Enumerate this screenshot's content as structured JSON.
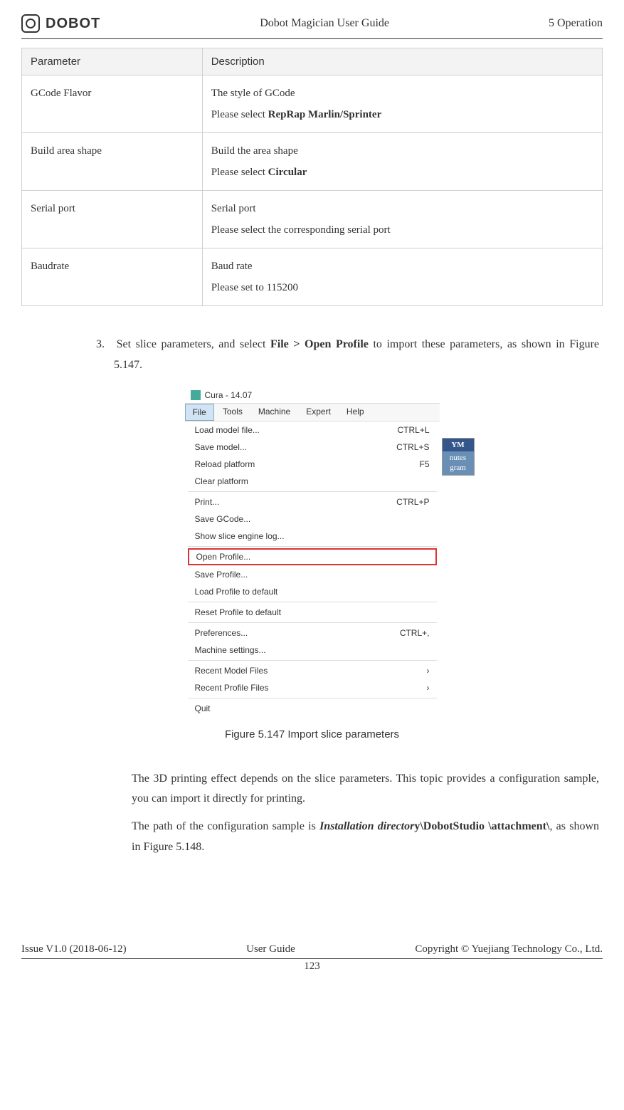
{
  "header": {
    "logo": "DOBOT",
    "title": "Dobot Magician User Guide",
    "section": "5 Operation"
  },
  "table": {
    "col_param": "Parameter",
    "col_desc": "Description",
    "rows": [
      {
        "param": "GCode Flavor",
        "desc_line1": "The style of GCode",
        "desc_prefix": "Please select ",
        "desc_bold": "RepRap Marlin/Sprinter"
      },
      {
        "param": "Build area shape",
        "desc_line1": "Build the area shape",
        "desc_prefix": "Please select ",
        "desc_bold": "Circular"
      },
      {
        "param": "Serial port",
        "desc_line1": "Serial port",
        "desc_prefix": "Please select the corresponding serial port",
        "desc_bold": ""
      },
      {
        "param": "Baudrate",
        "desc_line1": "Baud rate",
        "desc_prefix": "Please set to 115200",
        "desc_bold": ""
      }
    ]
  },
  "step3": {
    "num": "3.",
    "text_pre": "Set slice parameters, and select ",
    "text_bold": "File > Open Profile",
    "text_post": " to import these parameters, as shown in Figure 5.147."
  },
  "screenshot": {
    "title": "Cura - 14.07",
    "menubar": [
      "File",
      "Tools",
      "Machine",
      "Expert",
      "Help"
    ],
    "menu_groups": [
      [
        {
          "label": "Load model file...",
          "shortcut": "CTRL+L"
        },
        {
          "label": "Save model...",
          "shortcut": "CTRL+S"
        },
        {
          "label": "Reload platform",
          "shortcut": "F5"
        },
        {
          "label": "Clear platform",
          "shortcut": ""
        }
      ],
      [
        {
          "label": "Print...",
          "shortcut": "CTRL+P"
        },
        {
          "label": "Save GCode...",
          "shortcut": ""
        },
        {
          "label": "Show slice engine log...",
          "shortcut": ""
        }
      ],
      [
        {
          "label": "Open Profile...",
          "shortcut": "",
          "highlight": true
        },
        {
          "label": "Save Profile...",
          "shortcut": ""
        },
        {
          "label": "Load Profile to default",
          "shortcut": ""
        }
      ],
      [
        {
          "label": "Reset Profile to default",
          "shortcut": ""
        }
      ],
      [
        {
          "label": "Preferences...",
          "shortcut": "CTRL+,"
        },
        {
          "label": "Machine settings...",
          "shortcut": ""
        }
      ],
      [
        {
          "label": "Recent Model Files",
          "shortcut": "›"
        },
        {
          "label": "Recent Profile Files",
          "shortcut": "›"
        }
      ],
      [
        {
          "label": "Quit",
          "shortcut": ""
        }
      ]
    ],
    "side_badge": {
      "hdr": "YM",
      "l1": "nutes",
      "l2": "gram"
    }
  },
  "figure_caption": "Figure 5.147    Import slice parameters",
  "para1": "The 3D printing effect depends on the slice parameters. This topic provides a configuration sample, you can import it directly for printing.",
  "para2": {
    "pre": "The path of the configuration sample is ",
    "italic": "Installation director",
    "bold": "y\\DobotStudio \\attachment\\",
    "post": ", as shown in Figure 5.148."
  },
  "footer": {
    "issue": "Issue V1.0 (2018-06-12)",
    "guide": "User Guide",
    "copyright": "Copyright © Yuejiang Technology Co., Ltd.",
    "page": "123"
  }
}
